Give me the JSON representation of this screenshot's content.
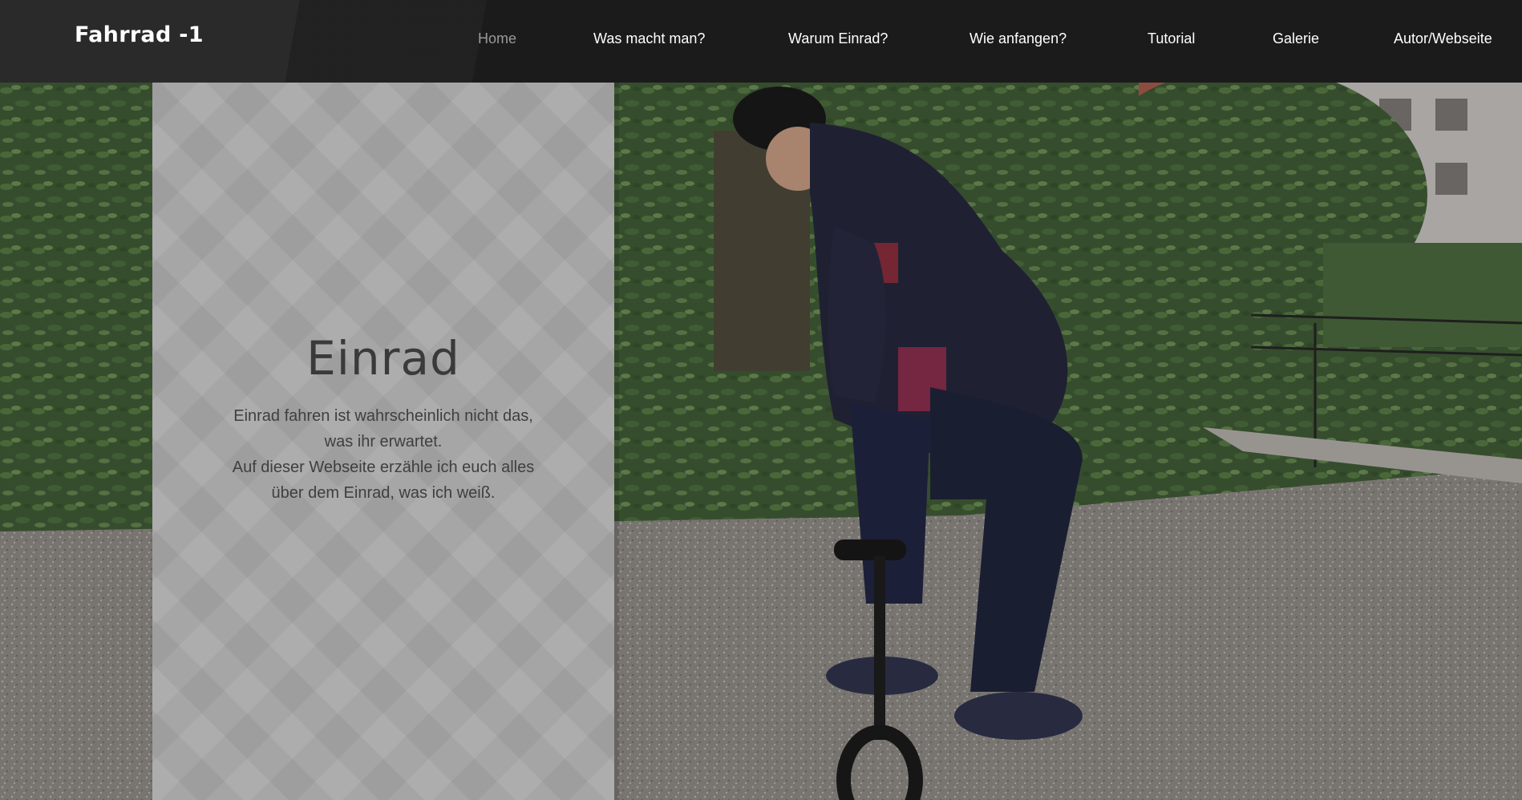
{
  "header": {
    "brand": "Fahrrad -1",
    "nav": [
      {
        "label": "Home",
        "active": true
      },
      {
        "label": "Was macht man?",
        "active": false
      },
      {
        "label": "Warum Einrad?",
        "active": false
      },
      {
        "label": "Wie anfangen?",
        "active": false
      },
      {
        "label": "Tutorial",
        "active": false
      },
      {
        "label": "Galerie",
        "active": false
      },
      {
        "label": "Autor/Webseite",
        "active": false
      }
    ]
  },
  "hero": {
    "title": "Einrad",
    "text_lines": [
      "Einrad fahren ist wahrscheinlich nicht das,",
      "was ihr erwartet.",
      "Auf dieser Webseite erzähle ich euch alles",
      "über dem Einrad, was ich weiß."
    ]
  },
  "colors": {
    "header_bg": "#1b1b1b",
    "nav_text": "#ffffff",
    "nav_active": "#9a9a9a",
    "panel_bg": "#a7a7a7",
    "panel_text": "#3f3f3f"
  }
}
